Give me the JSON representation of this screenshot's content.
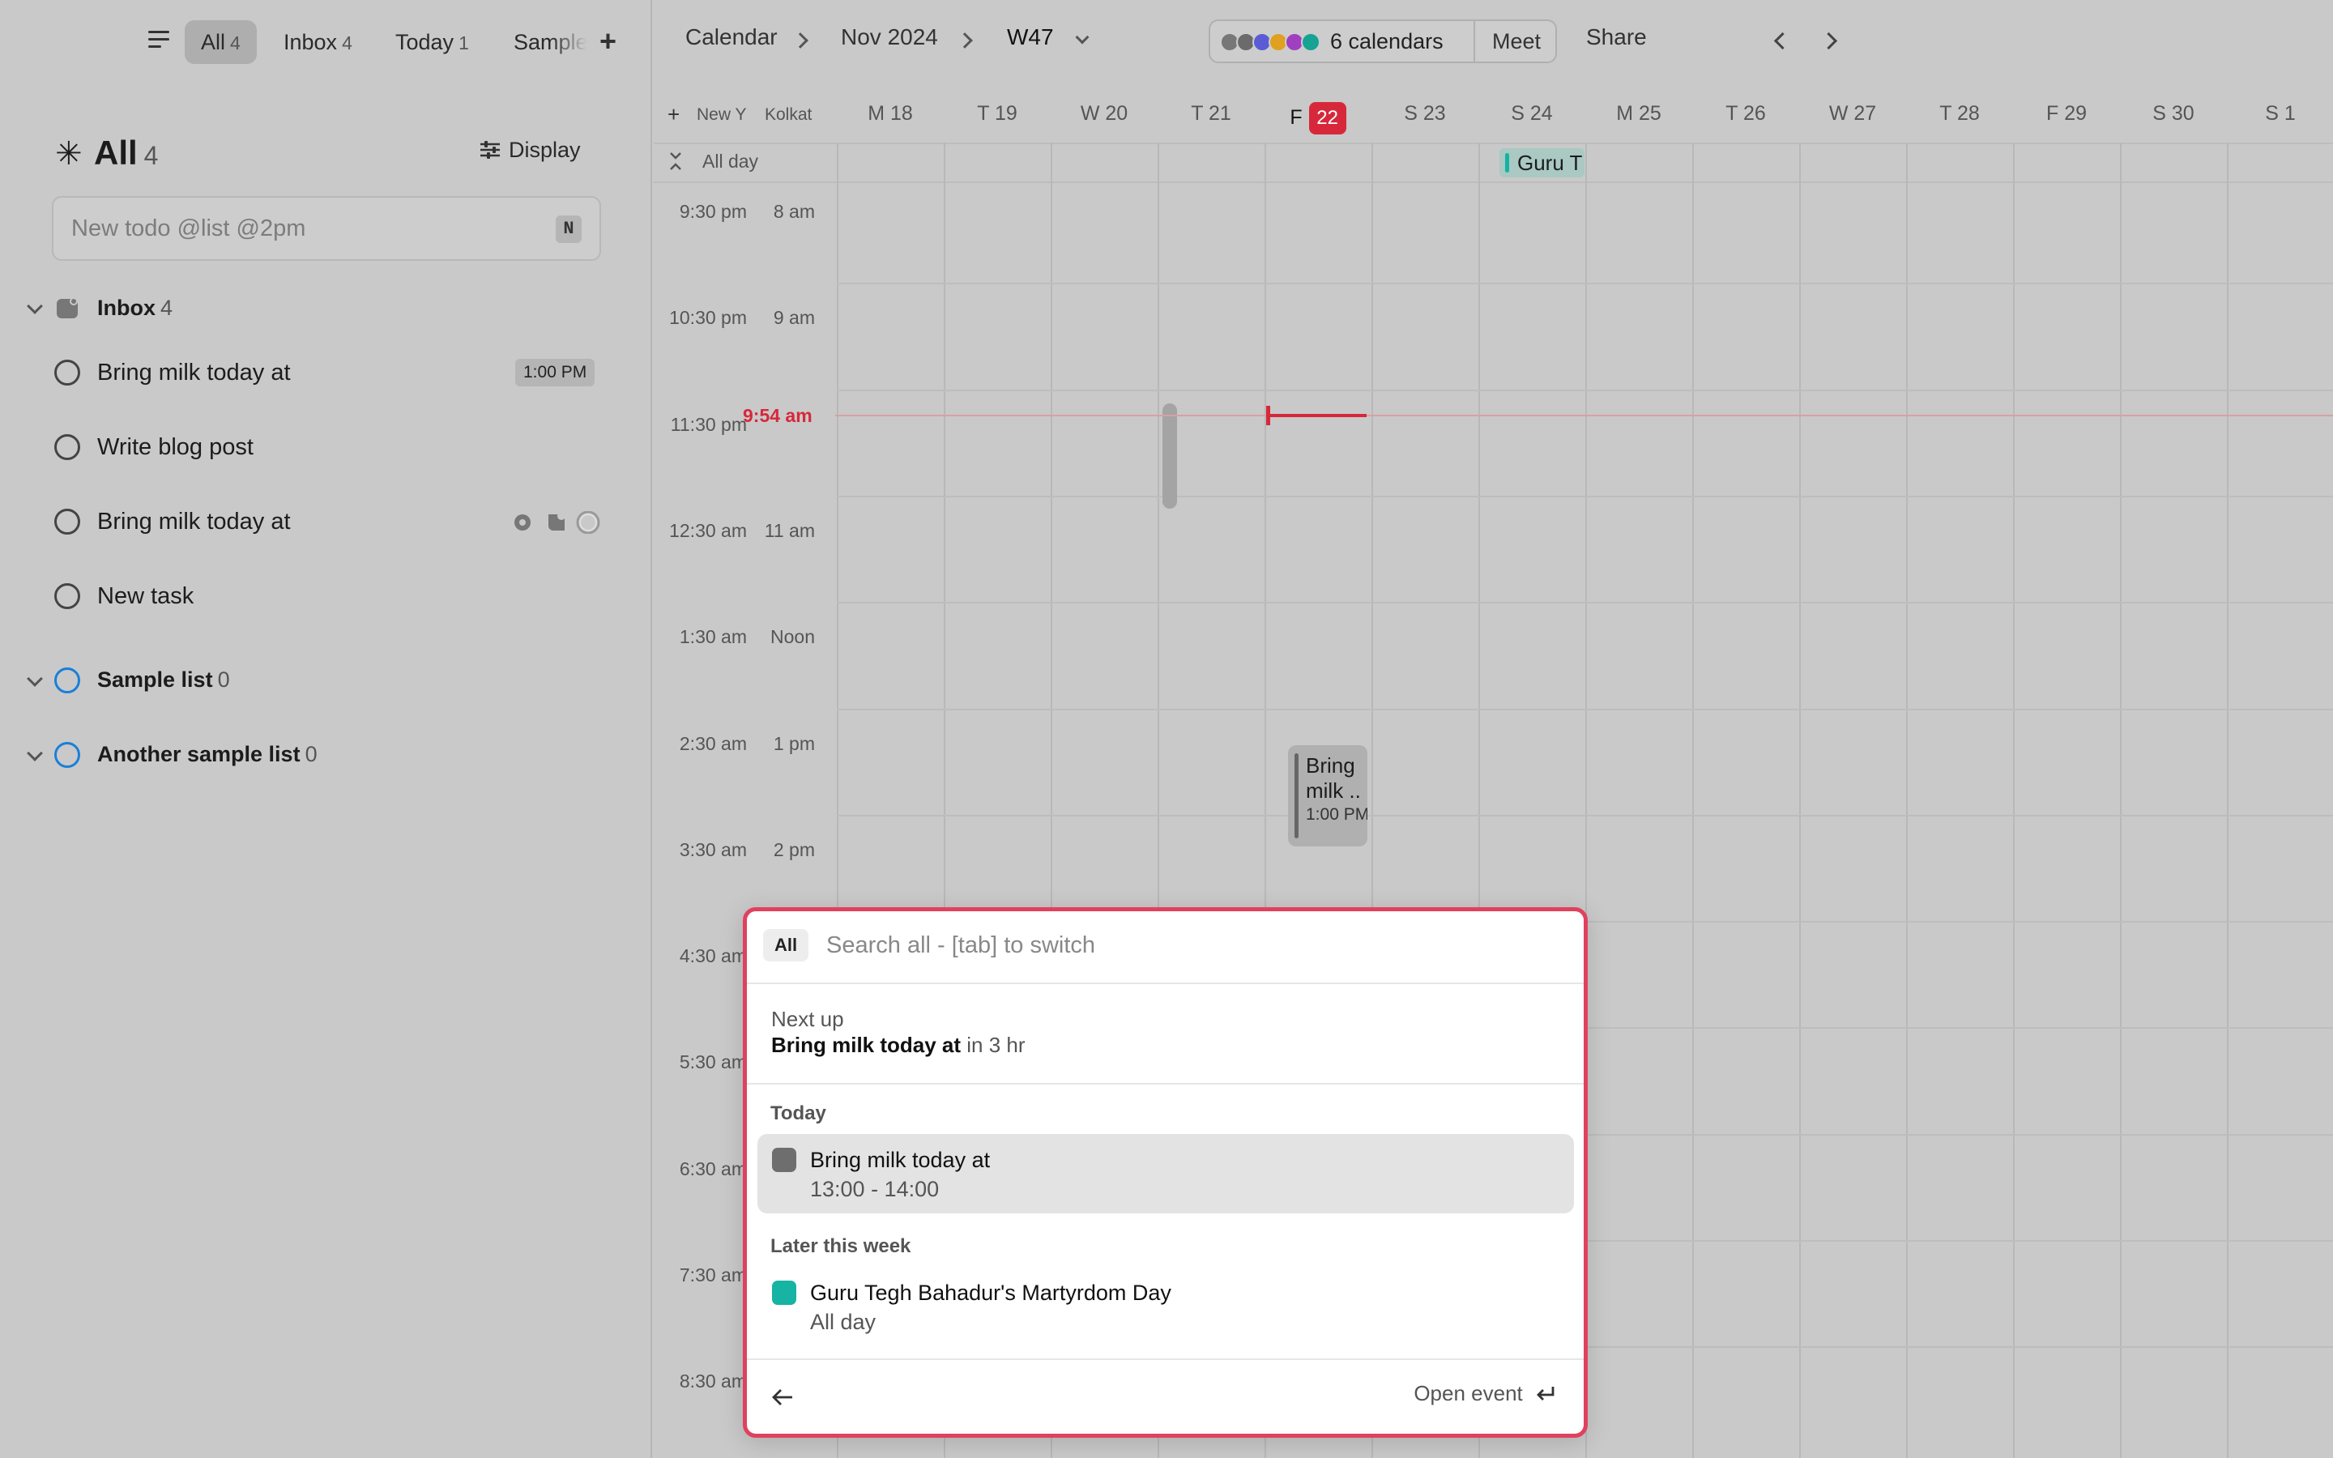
{
  "tabs": [
    {
      "label": "All",
      "count": "4"
    },
    {
      "label": "Inbox",
      "count": "4"
    },
    {
      "label": "Today",
      "count": "1"
    },
    {
      "label": "Sample"
    }
  ],
  "list_header": {
    "title": "All",
    "count": "4",
    "display_label": "Display"
  },
  "new_todo": {
    "placeholder": "New todo @list @2pm",
    "shortcut": "N"
  },
  "inbox": {
    "label": "Inbox",
    "count": "4"
  },
  "tasks": [
    {
      "label": "Bring milk today at",
      "time": "1:00 PM"
    },
    {
      "label": "Write blog post"
    },
    {
      "label": "Bring milk today at"
    },
    {
      "label": "New task"
    }
  ],
  "lists": [
    {
      "label": "Sample list",
      "count": "0"
    },
    {
      "label": "Another sample list",
      "count": "0"
    }
  ],
  "breadcrumb": {
    "calendar": "Calendar",
    "month": "Nov 2024",
    "week": "W47"
  },
  "calendars": {
    "count_label": "6 calendars",
    "colors": [
      "#777777",
      "#6b6b6b",
      "#5b5bd6",
      "#e0a020",
      "#a040c0",
      "#16a394"
    ]
  },
  "header_buttons": {
    "meet": "Meet",
    "share": "Share"
  },
  "timezones": {
    "new_label": "New Y",
    "local_label": "Kolkat"
  },
  "days": [
    "M 18",
    "T 19",
    "W 20",
    "T 21",
    "F",
    "S 23",
    "S 24",
    "M 25",
    "T 26",
    "W 27",
    "T 28",
    "F 29",
    "S 30",
    "S  1"
  ],
  "today_number": "22",
  "all_day_label": "All day",
  "all_day_event": "Guru T",
  "time_rows": [
    {
      "ny": "9:30 pm",
      "local": "8 am"
    },
    {
      "ny": "10:30 pm",
      "local": "9 am"
    },
    {
      "ny": "11:30 pm",
      "local": ""
    },
    {
      "ny": "12:30 am",
      "local": "11 am"
    },
    {
      "ny": "1:30 am",
      "local": "Noon"
    },
    {
      "ny": "2:30 am",
      "local": "1 pm"
    },
    {
      "ny": "3:30 am",
      "local": "2 pm"
    },
    {
      "ny": "4:30 am",
      "local": ""
    },
    {
      "ny": "5:30 am",
      "local": ""
    },
    {
      "ny": "6:30 am",
      "local": ""
    },
    {
      "ny": "7:30 am",
      "local": ""
    },
    {
      "ny": "8:30 am",
      "local": ""
    }
  ],
  "now_label": "9:54 am",
  "grid_event": {
    "title": "Bring milk ..",
    "time": "1:00 PM"
  },
  "search": {
    "scope": "All",
    "placeholder": "Search all - [tab] to switch",
    "next_up_label": "Next up",
    "next_up_title": "Bring milk today at",
    "next_up_when": "in 3 hr",
    "today_label": "Today",
    "today_item": {
      "title": "Bring milk today at",
      "time": "13:00 - 14:00",
      "color": "#6e6e6e"
    },
    "later_label": "Later this week",
    "later_item": {
      "title": "Guru Tegh Bahadur's Martyrdom Day",
      "time": "All day",
      "color": "#17b3a3"
    },
    "open_label": "Open event"
  }
}
